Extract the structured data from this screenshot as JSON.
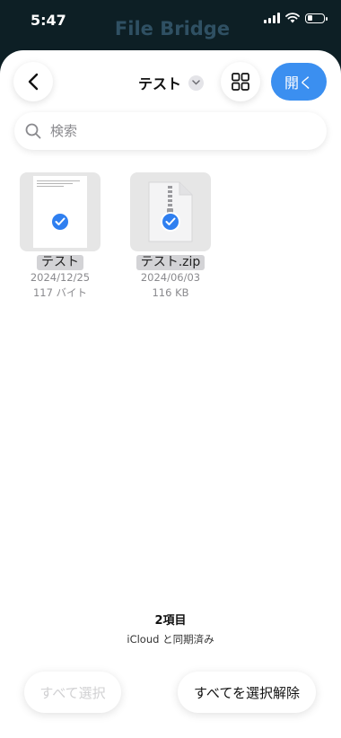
{
  "status_bar": {
    "time": "5:47",
    "app_title": "File Bridge"
  },
  "header": {
    "folder_name": "テスト",
    "open_label": "開く"
  },
  "search": {
    "placeholder": "検索"
  },
  "files": [
    {
      "name": "テスト",
      "date": "2024/12/25",
      "size": "117 バイト",
      "selected": true,
      "icon": "document-icon"
    },
    {
      "name": "テスト.zip",
      "date": "2024/06/03",
      "size": "116 KB",
      "selected": true,
      "icon": "zip-archive-icon"
    }
  ],
  "footer": {
    "count": "2項目",
    "sync": "iCloud と同期済み",
    "select_all_label": "すべて選択",
    "deselect_all_label": "すべてを選択解除"
  },
  "colors": {
    "accent": "#3b8ff0",
    "check": "#2f7ff0",
    "background": "#0d1f25"
  }
}
